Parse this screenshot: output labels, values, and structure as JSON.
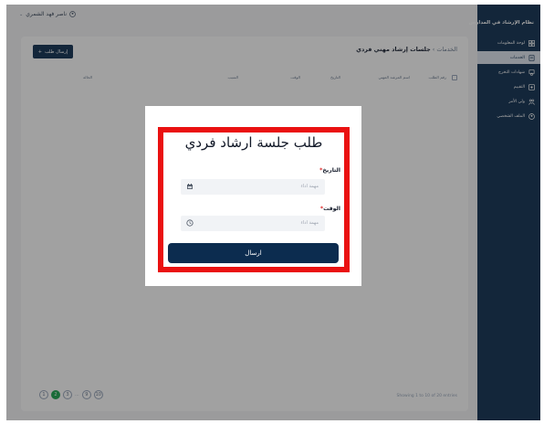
{
  "sidebar": {
    "brand": "نظام الإرشاد في المدارس",
    "items": [
      {
        "label": "لوحة المعلومات",
        "icon": "dashboard-icon",
        "active": false
      },
      {
        "label": "الخدمات",
        "icon": "document-icon",
        "active": true
      },
      {
        "label": "شهادات التخرج",
        "icon": "certificate-icon",
        "active": false
      },
      {
        "label": "التقييم",
        "icon": "evaluation-icon",
        "active": false
      },
      {
        "label": "ولي الأمر",
        "icon": "parents-icon",
        "active": false
      },
      {
        "label": "الملف الشخصي",
        "icon": "profile-icon",
        "active": false
      }
    ]
  },
  "topbar": {
    "user_name": "ناصر فهد الشمري"
  },
  "page": {
    "breadcrumb_parent": "الخدمات",
    "breadcrumb_sep": "›",
    "breadcrumb_current": "جلسات إرشاد مهني فردي",
    "send_request_label": "إرسال طلب",
    "columns": [
      "رقم الطلب",
      "اسم المرشد المهني",
      "التاريخ",
      "الوقت",
      "السبب",
      "الحالة"
    ],
    "showing_text": "Showing 1 to 10 of 20 entries",
    "pagination": [
      "1",
      "2",
      "3",
      "...",
      "9",
      "10"
    ]
  },
  "modal": {
    "title": "طلب جلسة ارشاد فردي",
    "date_label": "التاريخ",
    "date_placeholder": "مهمة اداء",
    "time_label": "الوقت",
    "time_placeholder": "مهمة اداء",
    "required_mark": "*",
    "submit_label": "ارسال"
  },
  "colors": {
    "primary": "#0c2c4f",
    "highlight_border": "#ea1111",
    "active_page": "#16a34a"
  }
}
